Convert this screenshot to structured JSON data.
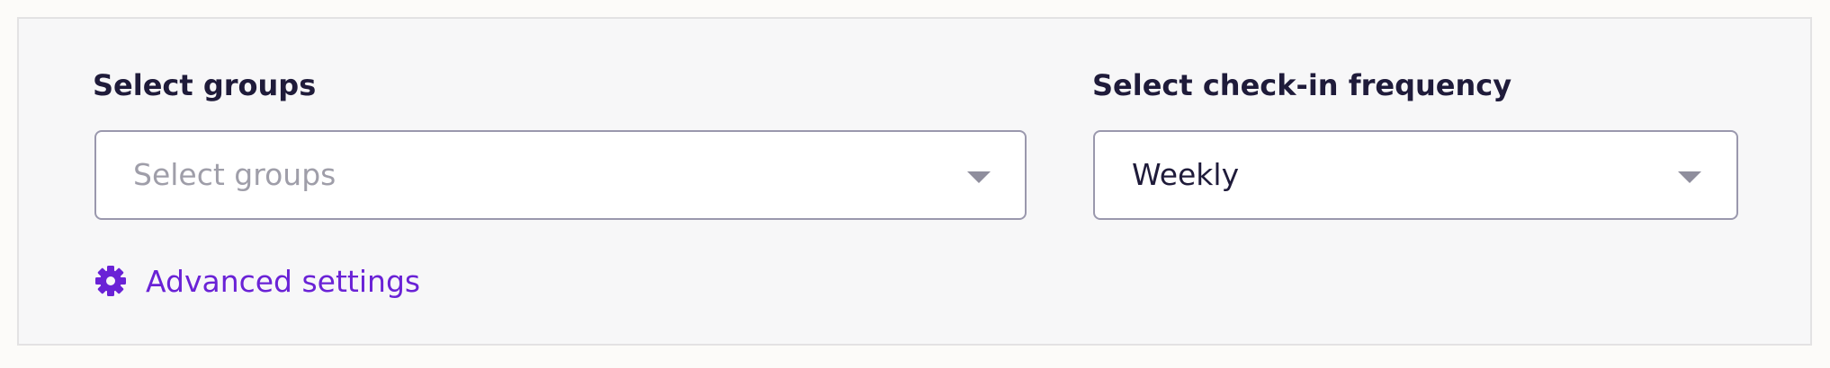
{
  "groups": {
    "label": "Select groups",
    "placeholder": "Select groups",
    "caret_icon": "caret-down-icon"
  },
  "frequency": {
    "label": "Select check-in frequency",
    "value": "Weekly",
    "caret_icon": "caret-down-icon"
  },
  "advanced": {
    "label": "Advanced settings",
    "icon": "gear-icon"
  },
  "colors": {
    "accent": "#6a22d6",
    "text": "#1f1b3a",
    "placeholder": "#9f9ea9",
    "border": "#9a98ad",
    "panel_bg": "#f7f7f8"
  }
}
